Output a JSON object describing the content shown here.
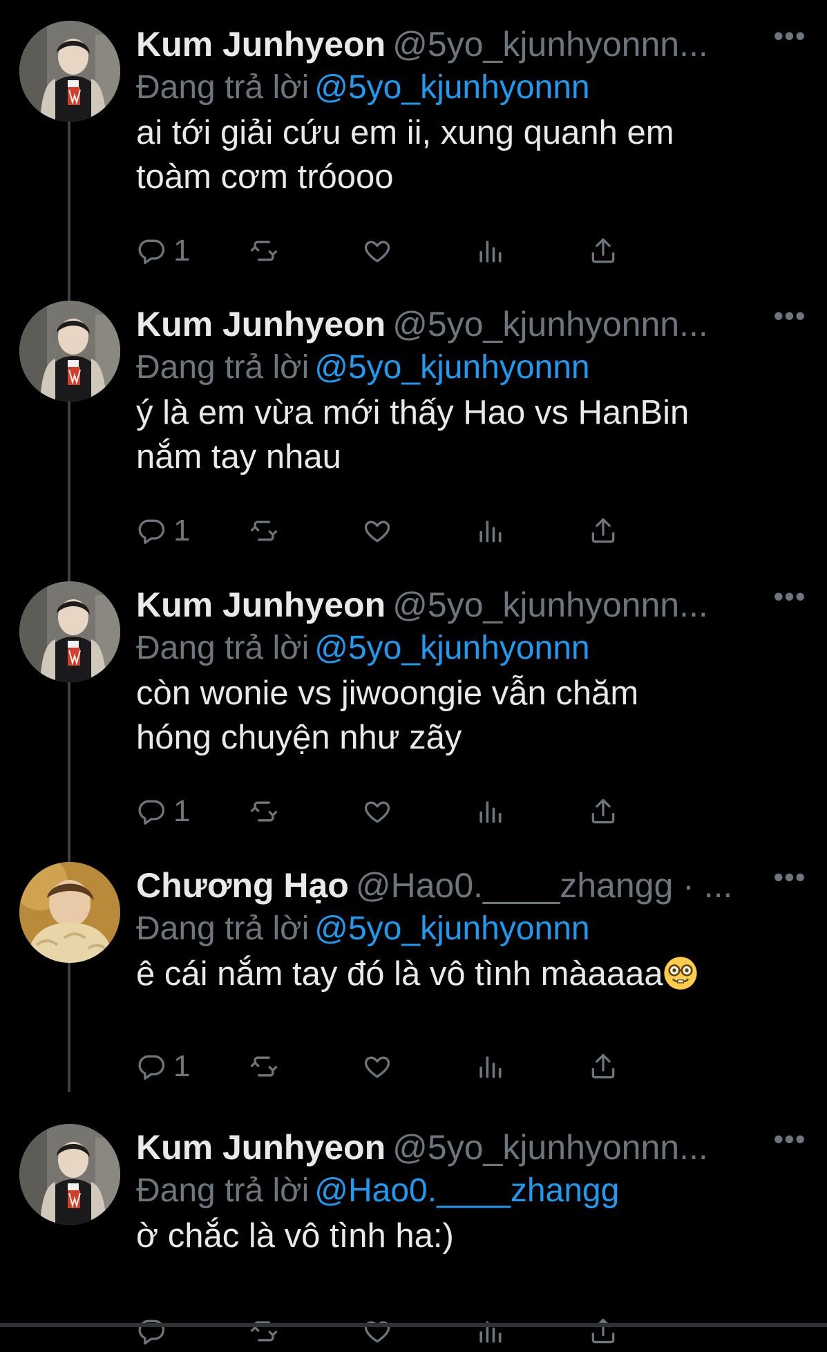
{
  "tweets": [
    {
      "name": "Kum Junhyeon",
      "handle": "@5yo_kjunhyonnn...",
      "replying_label": "Đang trả lời",
      "replying_to": "@5yo_kjunhyonnn",
      "text_lines": [
        "ai tới giải cứu em ii, xung quanh em",
        "toàm cơm tróooo"
      ],
      "reply_count": "1",
      "avatar": "boy-jacket"
    },
    {
      "name": "Kum Junhyeon",
      "handle": "@5yo_kjunhyonnn...",
      "replying_label": "Đang trả lời",
      "replying_to": "@5yo_kjunhyonnn",
      "text_lines": [
        "ý là em vừa mới thấy Hao vs HanBin",
        "nắm tay nhau"
      ],
      "reply_count": "1",
      "avatar": "boy-jacket"
    },
    {
      "name": "Kum Junhyeon",
      "handle": "@5yo_kjunhyonnn...",
      "replying_label": "Đang trả lời",
      "replying_to": "@5yo_kjunhyonnn",
      "text_lines": [
        "còn wonie vs jiwoongie vẫn chăm",
        "hóng chuyện như zãy"
      ],
      "reply_count": "1",
      "avatar": "boy-jacket"
    },
    {
      "name": "Chương Hạo",
      "handle": "@Hao0.____zhangg · ...",
      "replying_label": "Đang trả lời",
      "replying_to": "@5yo_kjunhyonnn",
      "text_lines": [
        "ê cái nắm tay đó là vô tình màaaaa"
      ],
      "reply_count": "1",
      "avatar": "boy-sweater",
      "emoji": "nerd-face"
    },
    {
      "name": "Kum Junhyeon",
      "handle": "@5yo_kjunhyonnn...",
      "replying_label": "Đang trả lời",
      "replying_to": "@Hao0.____zhangg",
      "text_lines": [
        "ờ chắc là vô tình ha:)"
      ],
      "reply_count": "",
      "avatar": "boy-jacket"
    }
  ],
  "icons": {
    "more": "more-horizontal-icon",
    "reply": "reply-icon",
    "retweet": "retweet-icon",
    "like": "heart-icon",
    "views": "analytics-icon",
    "share": "share-icon"
  },
  "colors": {
    "background": "#000000",
    "primary_text": "#e7e9ea",
    "secondary_text": "#6e767d",
    "mention": "#1d9bf0",
    "thread_line": "#3e4144"
  }
}
